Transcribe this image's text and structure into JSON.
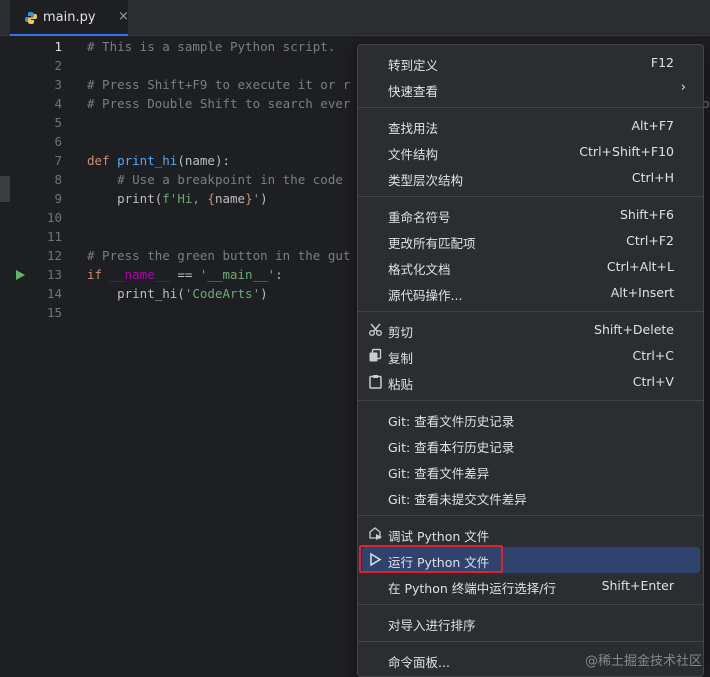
{
  "tab": {
    "filename": "main.py",
    "close_glyph": "×"
  },
  "editor": {
    "lines": [
      {
        "n": "1",
        "parts": [
          {
            "cls": "cmt",
            "t": "# This is a sample Python script."
          }
        ]
      },
      {
        "n": "2",
        "parts": []
      },
      {
        "n": "3",
        "parts": [
          {
            "cls": "cmt",
            "t": "# Press Shift+F9 to execute it or r"
          }
        ]
      },
      {
        "n": "4",
        "parts": [
          {
            "cls": "cmt",
            "t": "# Press Double Shift to search ever"
          }
        ]
      },
      {
        "n": "5",
        "parts": []
      },
      {
        "n": "6",
        "parts": []
      },
      {
        "n": "7",
        "parts": [
          {
            "cls": "kw",
            "t": "def "
          },
          {
            "cls": "fn",
            "t": "print_hi"
          },
          {
            "cls": "",
            "t": "("
          },
          {
            "cls": "param",
            "t": "name"
          },
          {
            "cls": "",
            "t": "):"
          }
        ]
      },
      {
        "n": "8",
        "parts": [
          {
            "cls": "",
            "t": "    "
          },
          {
            "cls": "cmt",
            "t": "# Use a breakpoint in the code"
          }
        ]
      },
      {
        "n": "9",
        "parts": [
          {
            "cls": "",
            "t": "    print("
          },
          {
            "cls": "str",
            "t": "f'Hi, "
          },
          {
            "cls": "brace",
            "t": "{"
          },
          {
            "cls": "",
            "t": "name"
          },
          {
            "cls": "brace",
            "t": "}"
          },
          {
            "cls": "str",
            "t": "'"
          },
          {
            "cls": "",
            "t": ")"
          }
        ]
      },
      {
        "n": "10",
        "parts": []
      },
      {
        "n": "11",
        "parts": []
      },
      {
        "n": "12",
        "parts": [
          {
            "cls": "cmt",
            "t": "# Press the green button in the gut"
          }
        ]
      },
      {
        "n": "13",
        "parts": [
          {
            "cls": "kw",
            "t": "if "
          },
          {
            "cls": "dunder",
            "t": "__name__"
          },
          {
            "cls": "",
            "t": " == "
          },
          {
            "cls": "str",
            "t": "'__main__'"
          },
          {
            "cls": "",
            "t": ":"
          }
        ]
      },
      {
        "n": "14",
        "parts": [
          {
            "cls": "",
            "t": "    print_hi("
          },
          {
            "cls": "str",
            "t": "'CodeArts'"
          },
          {
            "cls": "",
            "t": ")"
          }
        ]
      },
      {
        "n": "15",
        "parts": []
      }
    ],
    "line4_overflow": "o"
  },
  "menu": {
    "items": [
      {
        "label": "转到定义",
        "shortcut": "F12"
      },
      {
        "label": "快速查看",
        "shortcut": "",
        "submenu": "›"
      },
      {
        "label": "查找用法",
        "shortcut": "Alt+F7"
      },
      {
        "label": "文件结构",
        "shortcut": "Ctrl+Shift+F10"
      },
      {
        "label": "类型层次结构",
        "shortcut": "Ctrl+H"
      },
      {
        "label": "重命名符号",
        "shortcut": "Shift+F6"
      },
      {
        "label": "更改所有匹配项",
        "shortcut": "Ctrl+F2"
      },
      {
        "label": "格式化文档",
        "shortcut": "Ctrl+Alt+L"
      },
      {
        "label": "源代码操作...",
        "shortcut": "Alt+Insert"
      },
      {
        "label": "剪切",
        "shortcut": "Shift+Delete",
        "icon": "scissors-icon"
      },
      {
        "label": "复制",
        "shortcut": "Ctrl+C",
        "icon": "copy-icon"
      },
      {
        "label": "粘贴",
        "shortcut": "Ctrl+V",
        "icon": "clipboard-icon"
      },
      {
        "label": "Git: 查看文件历史记录",
        "shortcut": ""
      },
      {
        "label": "Git: 查看本行历史记录",
        "shortcut": ""
      },
      {
        "label": "Git: 查看文件差异",
        "shortcut": ""
      },
      {
        "label": "Git: 查看未提交文件差异",
        "shortcut": ""
      },
      {
        "label": "调试 Python 文件",
        "shortcut": "",
        "icon": "debug-icon"
      },
      {
        "label": "运行 Python 文件",
        "shortcut": "",
        "icon": "run-triangle-icon",
        "highlighted": true
      },
      {
        "label": "在 Python 终端中运行选择/行",
        "shortcut": "Shift+Enter"
      },
      {
        "label": "对导入进行排序",
        "shortcut": ""
      },
      {
        "label": "命令面板...",
        "shortcut": ""
      }
    ]
  },
  "watermark": "@稀土掘金技术社区",
  "colors": {
    "accent": "#3574f0",
    "highlight_box": "#e0232a",
    "run_green": "#5fb865"
  }
}
